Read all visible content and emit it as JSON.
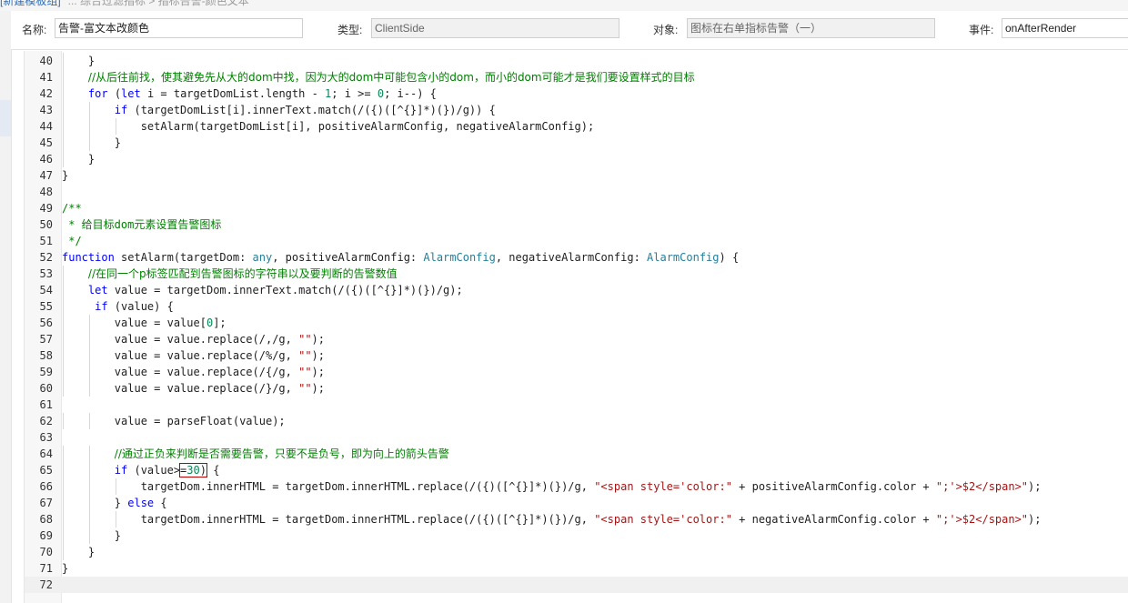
{
  "breadcrumb": {
    "link": "[新建模板组]",
    "rest": "...  综合过滤指标 > 指标告警-颜色文本"
  },
  "form": {
    "name_label": "名称:",
    "name_value": "告警-富文本改颜色",
    "type_label": "类型:",
    "type_value": "ClientSide",
    "target_label": "对象:",
    "target_value": "图标在右单指标告警（一）",
    "event_label": "事件:",
    "event_value": "onAfterRender"
  },
  "editor": {
    "active_line": 72,
    "lines": [
      {
        "n": "40",
        "indent": 1,
        "code": "    }"
      },
      {
        "n": "41",
        "indent": 1,
        "code": "    //从后往前找，使其避免先从大的dom中找，因为大的dom中可能包含小的dom，而小的dom可能才是我们要设置样式的目标"
      },
      {
        "n": "42",
        "indent": 1,
        "code": "    for (let i = targetDomList.length - 1; i >= 0; i--) {"
      },
      {
        "n": "43",
        "indent": 2,
        "code": "        if (targetDomList[i].innerText.match(/({)([^{}]*)(})/g)) {"
      },
      {
        "n": "44",
        "indent": 3,
        "code": "            setAlarm(targetDomList[i], positiveAlarmConfig, negativeAlarmConfig);"
      },
      {
        "n": "45",
        "indent": 2,
        "code": "        }"
      },
      {
        "n": "46",
        "indent": 1,
        "code": "    }"
      },
      {
        "n": "47",
        "indent": 0,
        "code": "}"
      },
      {
        "n": "48",
        "indent": 0,
        "code": ""
      },
      {
        "n": "49",
        "indent": 0,
        "code": "/**"
      },
      {
        "n": "50",
        "indent": 0,
        "code": " * 给目标dom元素设置告警图标"
      },
      {
        "n": "51",
        "indent": 0,
        "code": " */"
      },
      {
        "n": "52",
        "indent": 0,
        "code": "function setAlarm(targetDom: any, positiveAlarmConfig: AlarmConfig, negativeAlarmConfig: AlarmConfig) {"
      },
      {
        "n": "53",
        "indent": 1,
        "code": "    //在同一个p标签匹配到告警图标的字符串以及要判断的告警数值"
      },
      {
        "n": "54",
        "indent": 1,
        "code": "    let value = targetDom.innerText.match(/({)([^{}]*)(})/g);"
      },
      {
        "n": "55",
        "indent": 1,
        "code": "     if (value) {"
      },
      {
        "n": "56",
        "indent": 2,
        "code": "        value = value[0];"
      },
      {
        "n": "57",
        "indent": 2,
        "code": "        value = value.replace(/,/g, \"\");"
      },
      {
        "n": "58",
        "indent": 2,
        "code": "        value = value.replace(/%/g, \"\");"
      },
      {
        "n": "59",
        "indent": 2,
        "code": "        value = value.replace(/{/g, \"\");"
      },
      {
        "n": "60",
        "indent": 2,
        "code": "        value = value.replace(/}/g, \"\");"
      },
      {
        "n": "61",
        "indent": 2,
        "code": ""
      },
      {
        "n": "62",
        "indent": 2,
        "code": "        value = parseFloat(value);"
      },
      {
        "n": "63",
        "indent": 2,
        "code": ""
      },
      {
        "n": "64",
        "indent": 2,
        "code": "        //通过正负来判断是否需要告警，只要不是负号，即为向上的箭头告警"
      },
      {
        "n": "65",
        "indent": 2,
        "code": "        if (value>=30) {"
      },
      {
        "n": "66",
        "indent": 3,
        "code": "            targetDom.innerHTML = targetDom.innerHTML.replace(/({)([^{}]*)(})/g, \"<span style='color:\" + positiveAlarmConfig.color + \";'>$2</span>\");"
      },
      {
        "n": "67",
        "indent": 2,
        "code": "        } else {"
      },
      {
        "n": "68",
        "indent": 3,
        "code": "            targetDom.innerHTML = targetDom.innerHTML.replace(/({)([^{}]*)(})/g, \"<span style='color:\" + negativeAlarmConfig.color + \";'>$2</span>\");"
      },
      {
        "n": "69",
        "indent": 2,
        "code": "        }"
      },
      {
        "n": "70",
        "indent": 1,
        "code": "    }"
      },
      {
        "n": "71",
        "indent": 0,
        "code": "}"
      },
      {
        "n": "72",
        "indent": 0,
        "code": ""
      }
    ],
    "highlight": {
      "line": "65",
      "text": "=30)"
    }
  },
  "colors": {
    "keyword": "#0000ff",
    "comment": "#008000",
    "type": "#267f99",
    "string": "#a31515",
    "number": "#098658",
    "highlight_box": "#c00000"
  }
}
